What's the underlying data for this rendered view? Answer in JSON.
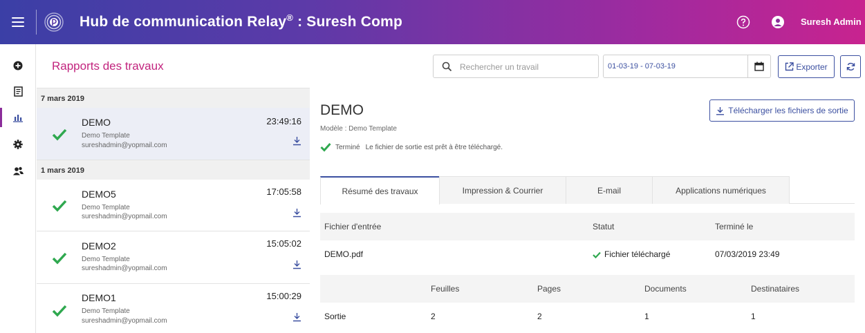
{
  "header": {
    "title_main": "Hub de communication Relay",
    "title_reg": "®",
    "title_suffix": " : Suresh Comp",
    "user_name": "Suresh Admin",
    "gradient_start": "#3b3fa6",
    "gradient_end": "#c8238f"
  },
  "nav": {
    "items": [
      {
        "icon": "plus-circle-icon"
      },
      {
        "icon": "document-icon"
      },
      {
        "icon": "bar-chart-icon",
        "active": true
      },
      {
        "icon": "gear-icon"
      },
      {
        "icon": "users-icon"
      }
    ]
  },
  "toolbar": {
    "page_title": "Rapports des travaux",
    "search_placeholder": "Rechercher un travail",
    "date_range": "01-03-19 - 07-03-19",
    "export_label": "Exporter"
  },
  "groups": [
    {
      "date": "7 mars 2019",
      "jobs": [
        {
          "name": "DEMO",
          "template": "Demo Template",
          "email": "sureshadmin@yopmail.com",
          "time": "23:49:16",
          "selected": true
        }
      ]
    },
    {
      "date": "1 mars 2019",
      "jobs": [
        {
          "name": "DEMO5",
          "template": "Demo Template",
          "email": "sureshadmin@yopmail.com",
          "time": "17:05:58"
        },
        {
          "name": "DEMO2",
          "template": "Demo Template",
          "email": "sureshadmin@yopmail.com",
          "time": "15:05:02"
        },
        {
          "name": "DEMO1",
          "template": "Demo Template",
          "email": "sureshadmin@yopmail.com",
          "time": "15:00:29"
        }
      ]
    }
  ],
  "detail": {
    "title": "DEMO",
    "model": "Modèle : Demo Template",
    "status_label": "Terminé",
    "status_message": "Le fichier de sortie est prêt à être téléchargé.",
    "download_all_label": "Télécharger les fichiers de sortie",
    "tabs": [
      "Résumé des travaux",
      "Impression & Courrier",
      "E-mail",
      "Applications numériques"
    ],
    "input_table": {
      "headers": [
        "Fichier d'entrée",
        "Statut",
        "Terminé le"
      ],
      "row": {
        "file": "DEMO.pdf",
        "status": "Fichier téléchargé",
        "completed": "07/03/2019 23:49"
      }
    },
    "output_table": {
      "headers": [
        "",
        "Feuilles",
        "Pages",
        "Documents",
        "Destinataires"
      ],
      "row": {
        "label": "Sortie",
        "sheets": "2",
        "pages": "2",
        "documents": "1",
        "recipients": "1"
      }
    }
  },
  "colors": {
    "accent": "#3b4fa0",
    "title_pink": "#c2247e",
    "check_green": "#2fa84f"
  }
}
